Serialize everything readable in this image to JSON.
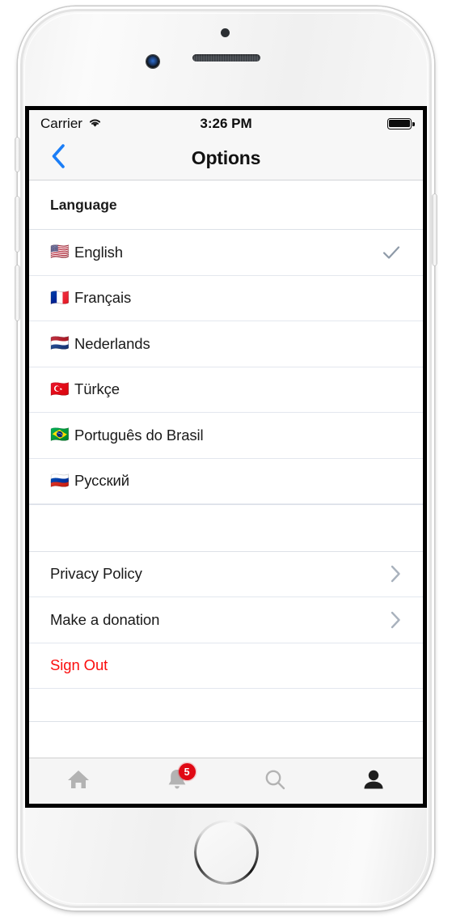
{
  "device": {
    "frame": "iphone-white",
    "accent_blue": "#1b7ef7",
    "destructive_red": "#fb0d0d",
    "badge_red": "#e00914"
  },
  "status_bar": {
    "carrier": "Carrier",
    "wifi_icon": "wifi-icon",
    "time": "3:26 PM",
    "battery_icon": "battery-full-icon"
  },
  "nav": {
    "back_icon": "chevron-left-icon",
    "title": "Options"
  },
  "sections": {
    "language": {
      "header": "Language",
      "items": [
        {
          "flag": "🇺🇸",
          "label": "English",
          "selected": true
        },
        {
          "flag": "🇫🇷",
          "label": "Français",
          "selected": false
        },
        {
          "flag": "🇳🇱",
          "label": "Nederlands",
          "selected": false
        },
        {
          "flag": "🇹🇷",
          "label": "Türkçe",
          "selected": false
        },
        {
          "flag": "🇧🇷",
          "label": "Português do Brasil",
          "selected": false
        },
        {
          "flag": "🇷🇺",
          "label": "Русский",
          "selected": false
        }
      ]
    },
    "links": {
      "items": [
        {
          "label": "Privacy Policy",
          "accessory": "chevron-right-icon"
        },
        {
          "label": "Make a donation",
          "accessory": "chevron-right-icon"
        }
      ]
    },
    "account": {
      "sign_out": "Sign Out"
    }
  },
  "tabbar": {
    "items": [
      {
        "name": "home",
        "icon": "home-icon",
        "active": false,
        "badge": null
      },
      {
        "name": "notifications",
        "icon": "bell-icon",
        "active": false,
        "badge": "5"
      },
      {
        "name": "search",
        "icon": "search-icon",
        "active": false,
        "badge": null
      },
      {
        "name": "profile",
        "icon": "person-icon",
        "active": true,
        "badge": null
      }
    ]
  }
}
